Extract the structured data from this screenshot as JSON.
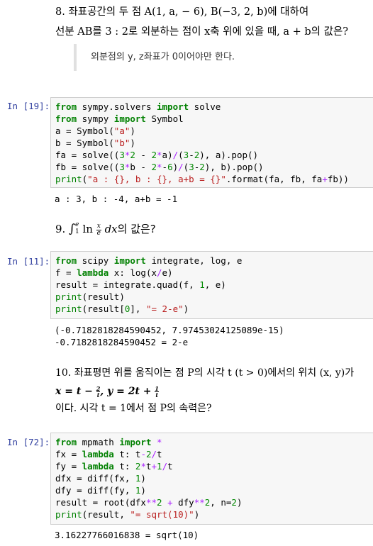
{
  "q8": {
    "line1": "8. 좌표공간의 두 점 A(1, a, − 6), B(−3, 2, b)에 대하여",
    "line2": "선분 AB를 3 : 2로 외분하는 점이 x축 위에 있을 때, a + b의 값은?",
    "note": "외분점의 y, z좌표가 0이어야만 한다."
  },
  "cell19": {
    "prompt": "In [19]:",
    "lines": [
      [
        "kw:from",
        " sympy.solvers ",
        "kw:import",
        " solve"
      ],
      [
        "kw:from",
        " sympy ",
        "kw:import",
        " Symbol"
      ],
      [
        "a = Symbol(",
        "str:\"a\"",
        ")"
      ],
      [
        "b = Symbol(",
        "str:\"b\"",
        ")"
      ],
      [
        "fa = solve((",
        "num:3",
        "op:*",
        "num:2",
        " - ",
        "num:2",
        "op:*",
        "a)",
        "op:/",
        "(",
        "num:3",
        "-",
        "num:2",
        "), a).pop()"
      ],
      [
        "fb = solve((",
        "num:3",
        "op:*",
        "b - ",
        "num:2",
        "op:*",
        "-",
        "num:6",
        ")",
        "op:/",
        "(",
        "num:3",
        "-",
        "num:2",
        "), b).pop()"
      ],
      [
        "bi:print",
        "(",
        "str:\"a : {}, b : {}, a+b = {}\"",
        ".format(fa, fb, fa",
        "op:+",
        "fb))"
      ]
    ],
    "output": "a : 3, b : -4, a+b = -1"
  },
  "q9": {
    "number": "9.",
    "integral_lower": "1",
    "integral_upper": "e",
    "ln": "ln",
    "frac_num": "x",
    "frac_den": "e",
    "dx": "dx",
    "suffix": "의 값은?"
  },
  "cell11": {
    "prompt": "In [11]:",
    "lines": [
      [
        "kw:from",
        " scipy ",
        "kw:import",
        " integrate, log, e"
      ],
      [
        "f = ",
        "kw:lambda",
        " x: log(x",
        "op:/",
        "e)"
      ],
      [
        "result = integrate.quad(f, ",
        "num:1",
        ", e)"
      ],
      [
        "bi:print",
        "(result)"
      ],
      [
        "bi:print",
        "(result[",
        "num:0",
        "], ",
        "str:\"= 2-e\"",
        ")"
      ]
    ],
    "output": "(-0.7182818284590452, 7.97453024125089e-15)\n-0.7182818284590452 = 2-e"
  },
  "q10": {
    "line1": "10. 좌표평면 위를 움직이는 점 P의 시각 t (t > 0)에서의 위치 (x, y)가",
    "line2_a": "x = t − ",
    "frac1_num": "2",
    "frac1_den": "t",
    "line2_b": ",  y = 2t + ",
    "frac2_num": "1",
    "frac2_den": "t",
    "line3": "이다. 시각 t = 1에서 점 P의 속력은?"
  },
  "cell72": {
    "prompt": "In [72]:",
    "lines": [
      [
        "kw:from",
        " mpmath ",
        "kw:import",
        " ",
        "op:*"
      ],
      [
        "fx = ",
        "kw:lambda",
        " t: t",
        "op:-",
        "num:2",
        "op:/",
        "t"
      ],
      [
        "fy = ",
        "kw:lambda",
        " t: ",
        "num:2",
        "op:*",
        "t",
        "op:+",
        "num:1",
        "op:/",
        "t"
      ],
      [
        "dfx = diff(fx, ",
        "num:1",
        ")"
      ],
      [
        "dfy = diff(fy, ",
        "num:1",
        ")"
      ],
      [
        "result = root(dfx",
        "op:**",
        "num:2",
        " ",
        "op:+",
        " dfy",
        "op:**",
        "num:2",
        ", n=",
        "num:2",
        ")"
      ],
      [
        "bi:print",
        "(result, ",
        "str:\"= sqrt(10)\"",
        ")"
      ]
    ],
    "output": "3.16227766016838 = sqrt(10)"
  },
  "colors": {
    "prompt": "#303f9f",
    "keyword": "#008000",
    "string": "#ba2121",
    "number": "#008800",
    "operator": "#aa22ff",
    "cell_bg": "#f7f7f7"
  }
}
